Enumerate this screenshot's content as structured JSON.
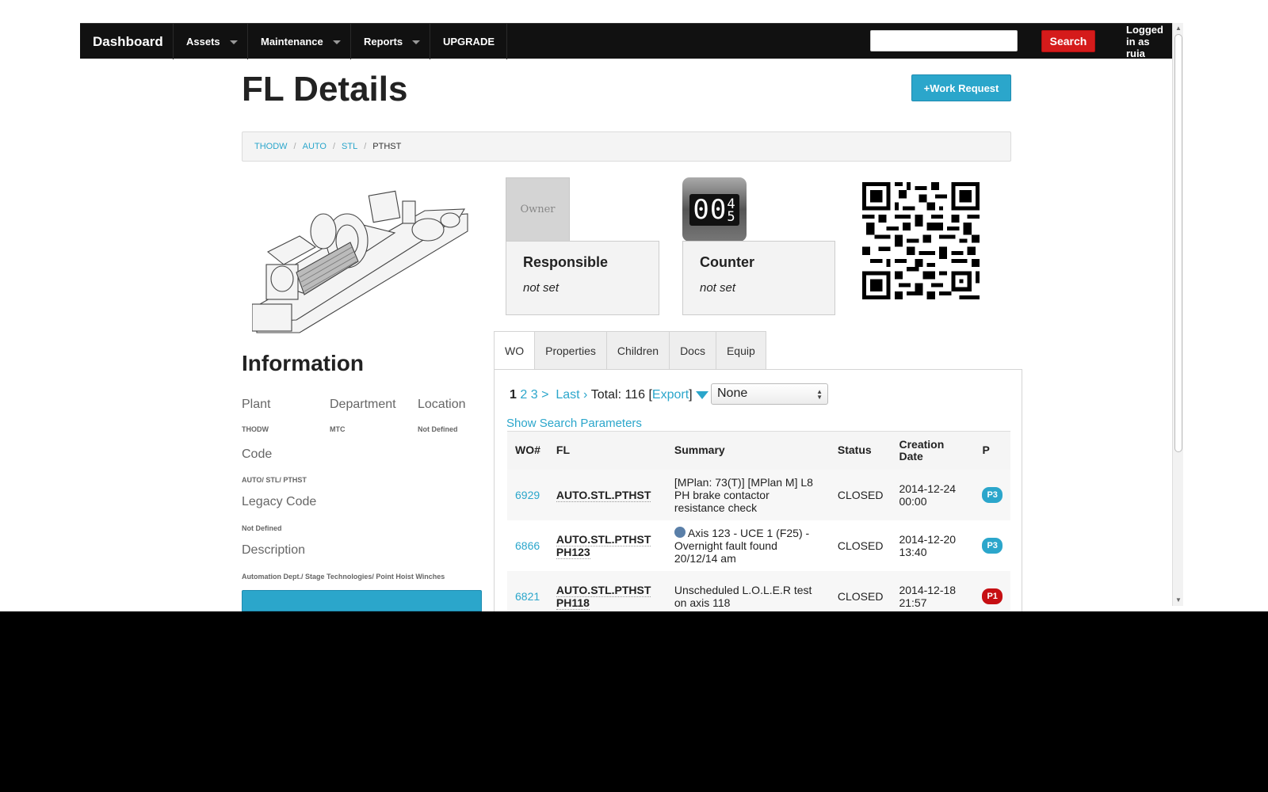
{
  "navbar": {
    "brand": "Dashboard",
    "menus": [
      "Assets",
      "Maintenance",
      "Reports"
    ],
    "upgrade": "UPGRADE",
    "search_button": "Search",
    "search_value": "",
    "user": "Logged in as ruia"
  },
  "header": {
    "title": "FL Details",
    "work_request_button": "+Work Request"
  },
  "breadcrumb": {
    "items": [
      "THODW",
      "AUTO",
      "STL"
    ],
    "current": "PTHST"
  },
  "cards": {
    "owner_placeholder": "Owner",
    "counter_digits": "00",
    "counter_roll": "4",
    "counter_roll_next": "5",
    "responsible": {
      "title": "Responsible",
      "value": "not set"
    },
    "counter": {
      "title": "Counter",
      "value": "not set"
    }
  },
  "information": {
    "title": "Information",
    "plant": {
      "label": "Plant",
      "value": "THODW"
    },
    "department": {
      "label": "Department",
      "value": "MTC"
    },
    "location": {
      "label": "Location",
      "value": "Not Defined"
    },
    "code": {
      "label": "Code",
      "value": "AUTO/ STL/ PTHST"
    },
    "legacy_code": {
      "label": "Legacy Code",
      "value": "Not Defined"
    },
    "description": {
      "label": "Description",
      "value": "Automation Dept./ Stage Technologies/ Point Hoist Winches"
    }
  },
  "tabs": [
    "WO",
    "Properties",
    "Children",
    "Docs",
    "Equip"
  ],
  "active_tab": "WO",
  "pager": {
    "current_page": "1",
    "pages": [
      "2",
      "3"
    ],
    "next": ">",
    "last": "Last ›",
    "total": "Total: 116",
    "export": "Export",
    "open_bracket": "[",
    "close_bracket": "]",
    "filter_value": "None",
    "show_search": "Show Search Parameters"
  },
  "table": {
    "headers": [
      "WO#",
      "FL",
      "Summary",
      "Status",
      "Creation Date",
      "P"
    ],
    "rows": [
      {
        "wo": "6929",
        "fl": "AUTO.STL.PTHST",
        "summary": "[MPlan: 73(T)] [MPlan M] L8 PH brake contactor resistance check",
        "status": "CLOSED",
        "date": "2014-12-24 00:00",
        "priority": "P3",
        "has_user_icon": false
      },
      {
        "wo": "6866",
        "fl": "AUTO.STL.PTHST PH123",
        "summary": "Axis 123 - UCE 1 (F25) - Overnight fault found 20/12/14 am",
        "status": "CLOSED",
        "date": "2014-12-20 13:40",
        "priority": "P3",
        "has_user_icon": true
      },
      {
        "wo": "6821",
        "fl": "AUTO.STL.PTHST PH118",
        "summary": "Unscheduled L.O.L.E.R test on axis 118",
        "status": "CLOSED",
        "date": "2014-12-18 21:57",
        "priority": "P1",
        "has_user_icon": false
      }
    ]
  },
  "colors": {
    "accent": "#2ba6cb",
    "search_button": "#d51b1b",
    "p1_badge": "#c60f13",
    "navbar": "#111111"
  }
}
